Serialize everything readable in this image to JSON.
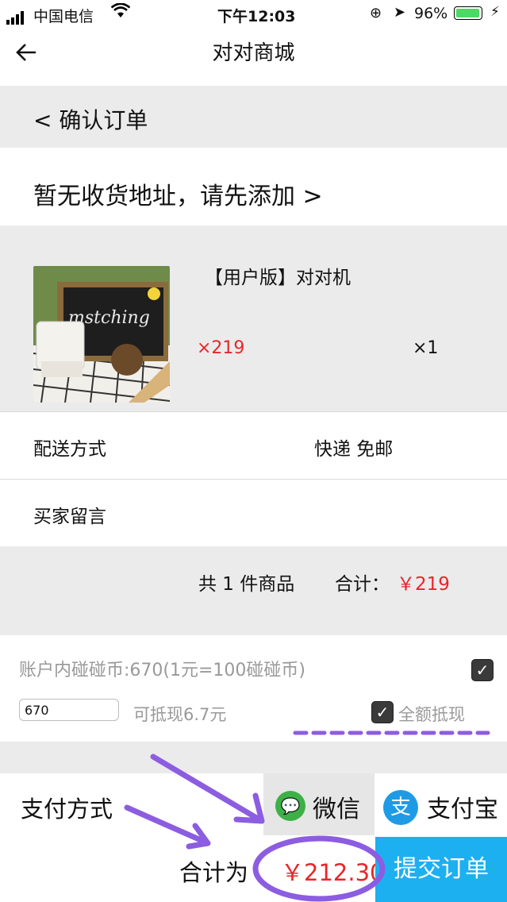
{
  "status_bar": {
    "carrier": "中国电信",
    "time": "下午12:03",
    "battery": "96%",
    "battery_level": 0.96
  },
  "nav": {
    "title": "对对商城"
  },
  "confirm_bar": {
    "text": "<  确认订单"
  },
  "address": {
    "text": "暂无收货地址，请先添加 >"
  },
  "product": {
    "name": "【用户版】对对机",
    "price": "×219",
    "quantity": "×1",
    "image_text": "mstching"
  },
  "delivery": {
    "label": "配送方式",
    "value": "快递 免邮"
  },
  "message": {
    "label": "买家留言"
  },
  "summary": {
    "count": "共 1 件商品",
    "total_label": "合计：",
    "total": "￥219"
  },
  "coins": {
    "info": "账户内碰碰币:670(1元=100碰碰币)",
    "input_value": "670",
    "deduct_text": "可抵现6.7元",
    "full_label": "全额抵现",
    "info_checked": true,
    "full_checked": true
  },
  "payment": {
    "label": "支付方式",
    "wechat": "微信",
    "alipay": "支付宝",
    "selected": "wechat"
  },
  "bottom": {
    "total_label": "合计为",
    "total_value": "￥212.30",
    "submit": "提交订单"
  },
  "colors": {
    "accent_red": "#e8262a",
    "submit_blue": "#1cb0f0",
    "annotation_purple": "#8c5de0"
  }
}
